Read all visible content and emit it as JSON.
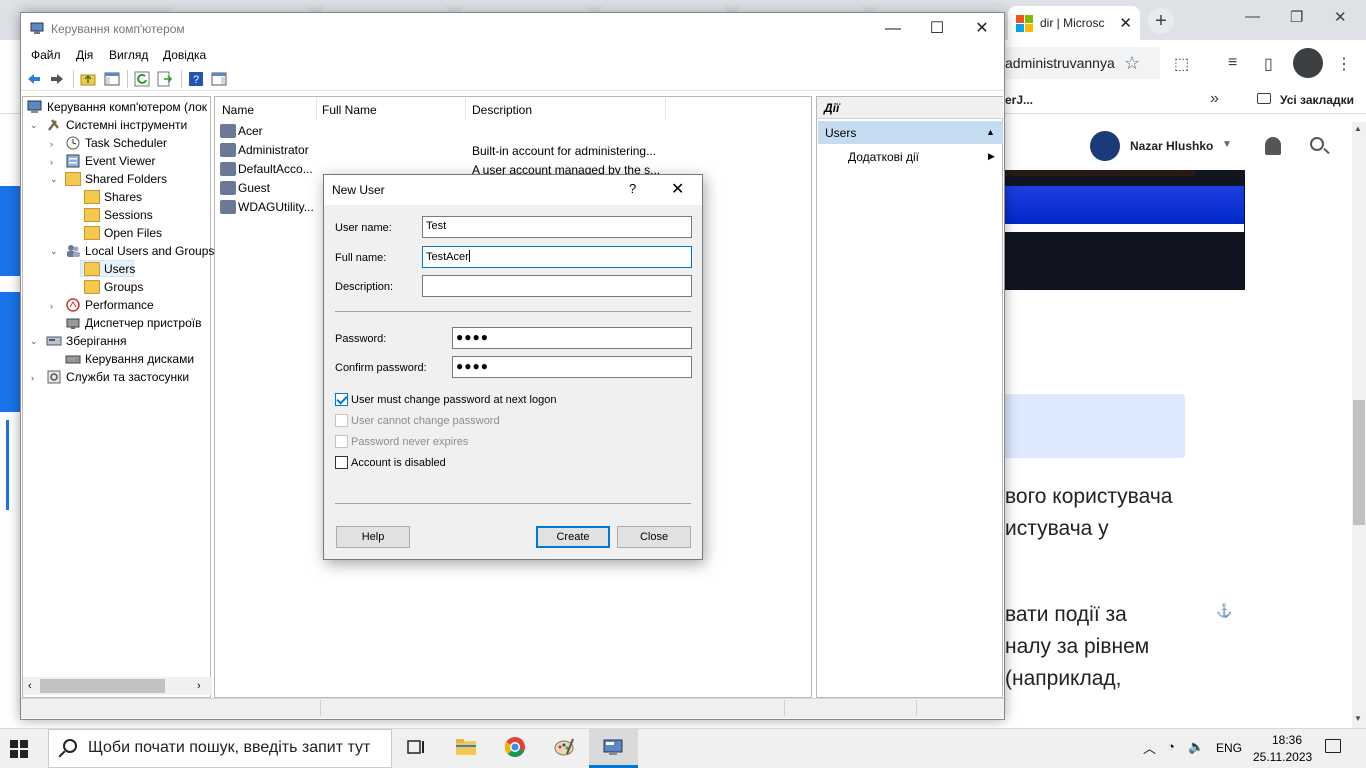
{
  "browser": {
    "active_tab_title": "dir | Microsc",
    "new_tab": "+",
    "url_fragment": "administruvannya",
    "bookmark_fragment": "erJ...",
    "bookmarks_more": "»",
    "all_bookmarks": "Усі закладки"
  },
  "website": {
    "user_name": "Nazar Hlushko",
    "article_lines": [
      "вого користувача",
      "истувача у",
      "вати події за",
      "налу за рівнем",
      "(наприклад,"
    ]
  },
  "mmc": {
    "title": "Керування комп'ютером",
    "menu": [
      "Файл",
      "Дія",
      "Вигляд",
      "Довідка"
    ],
    "tree": {
      "root": "Керування комп'ютером (лок",
      "system_tools": "Системні інструменти",
      "task_scheduler": "Task Scheduler",
      "event_viewer": "Event Viewer",
      "shared_folders": "Shared Folders",
      "shares": "Shares",
      "sessions": "Sessions",
      "open_files": "Open Files",
      "local_users_groups": "Local Users and Groups",
      "users": "Users",
      "groups": "Groups",
      "performance": "Performance",
      "device_manager": "Диспетчер пристроїв",
      "storage": "Зберігання",
      "disk_management": "Керування дисками",
      "services_apps": "Служби та застосунки"
    },
    "list": {
      "columns": [
        "Name",
        "Full Name",
        "Description"
      ],
      "rows": [
        {
          "name": "Acer",
          "full_name": "",
          "description": ""
        },
        {
          "name": "Administrator",
          "full_name": "",
          "description": "Built-in account for administering..."
        },
        {
          "name": "DefaultAcco...",
          "full_name": "",
          "description": "A user account managed by the s..."
        },
        {
          "name": "Guest",
          "full_name": "",
          "description": ""
        },
        {
          "name": "WDAGUtility...",
          "full_name": "",
          "description": ""
        }
      ]
    },
    "actions": {
      "header": "Дії",
      "section": "Users",
      "more_actions": "Додаткові дії"
    }
  },
  "dialog": {
    "title": "New User",
    "help_glyph": "?",
    "close_glyph": "✕",
    "user_name_label": "User name:",
    "user_name_value": "Test",
    "full_name_label": "Full name:",
    "full_name_value": "TestAcer",
    "description_label": "Description:",
    "description_value": "",
    "password_label": "Password:",
    "password_value": "●●●●",
    "confirm_label": "Confirm password:",
    "confirm_value": "●●●●",
    "checkboxes": [
      {
        "label": "User must change password at next logon",
        "checked": true,
        "enabled": true
      },
      {
        "label": "User cannot change password",
        "checked": false,
        "enabled": false
      },
      {
        "label": "Password never expires",
        "checked": false,
        "enabled": false
      },
      {
        "label": "Account is disabled",
        "checked": false,
        "enabled": true
      }
    ],
    "help_button": "Help",
    "create_button": "Create",
    "close_button": "Close"
  },
  "taskbar": {
    "search_placeholder": "Щоби почати пошук, введіть запит тут",
    "language": "ENG",
    "time": "18:36",
    "date": "25.11.2023"
  }
}
